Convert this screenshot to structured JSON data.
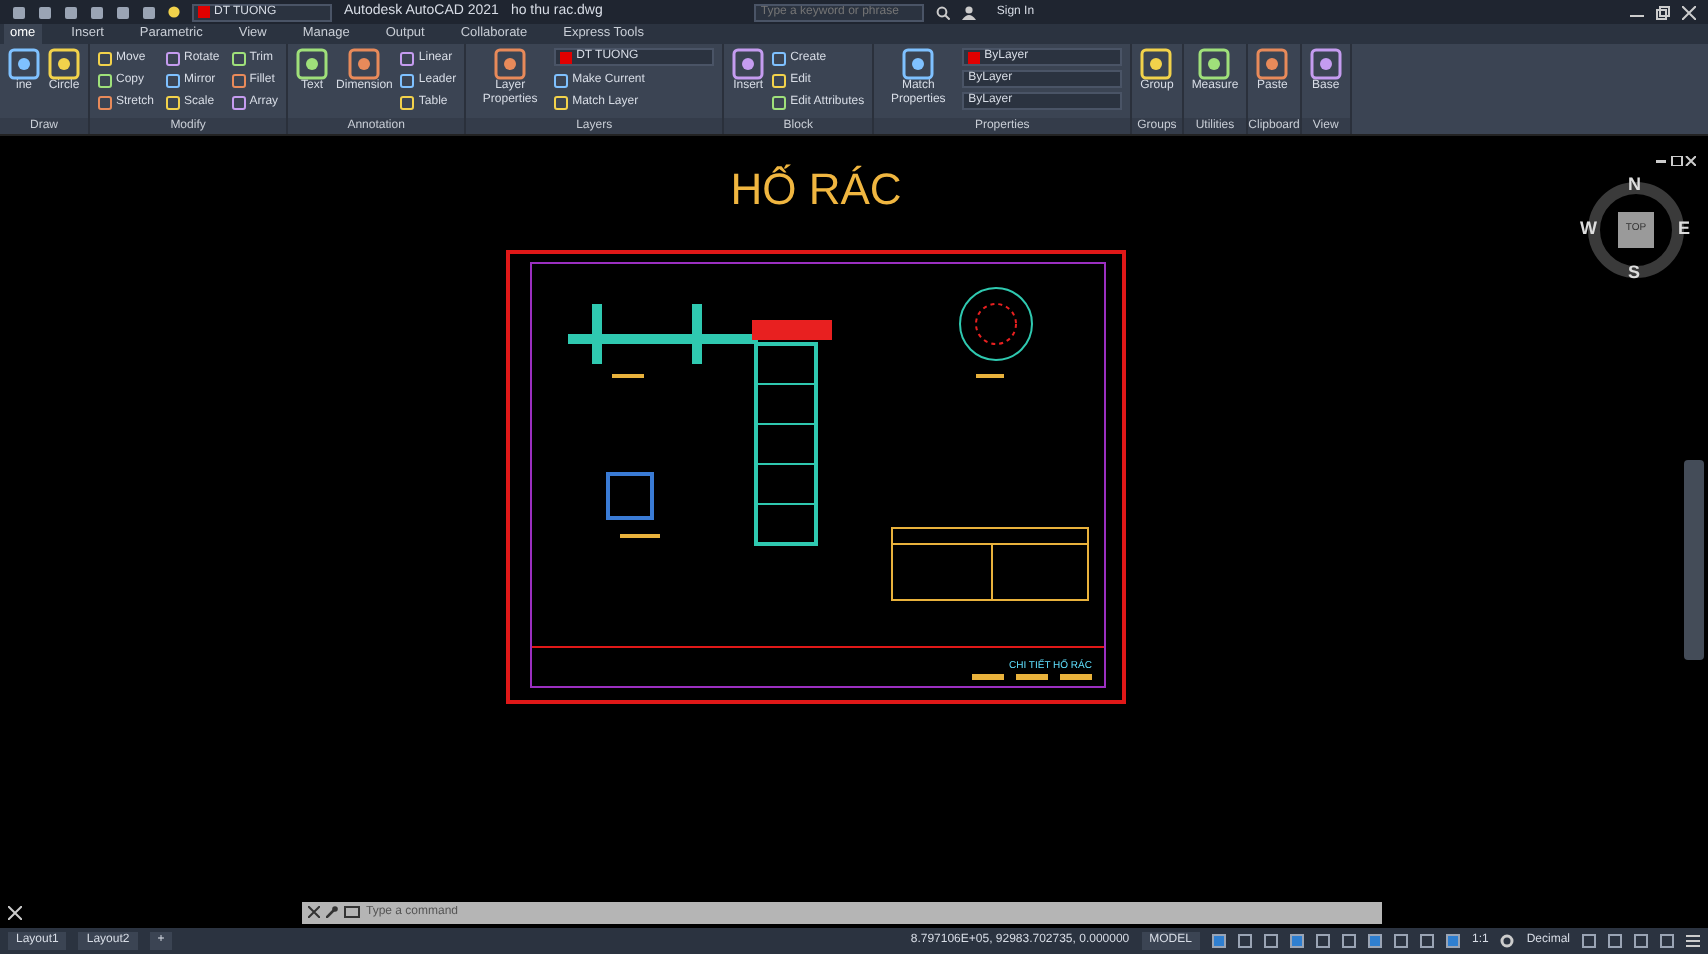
{
  "title_bar": {
    "quick_layer": "DT TUONG",
    "app_title": "Autodesk AutoCAD 2021",
    "file_name": "ho thu rac.dwg",
    "search": {
      "placeholder": "Type a keyword or phrase"
    },
    "sign_in": "Sign In"
  },
  "tabs": [
    {
      "label": "ome",
      "selected": true
    },
    {
      "label": "Insert",
      "selected": false
    },
    {
      "label": "Parametric",
      "selected": false
    },
    {
      "label": "View",
      "selected": false
    },
    {
      "label": "Manage",
      "selected": false
    },
    {
      "label": "Output",
      "selected": false
    },
    {
      "label": "Collaborate",
      "selected": false
    },
    {
      "label": "Express Tools",
      "selected": false
    }
  ],
  "panels": [
    {
      "title": "Draw",
      "tools": [
        {
          "kind": "large",
          "label": "ine"
        },
        {
          "kind": "large",
          "label": "Circle"
        }
      ]
    },
    {
      "title": "Modify",
      "tools": [
        {
          "kind": "small",
          "label": "Move"
        },
        {
          "kind": "small",
          "label": "Copy"
        },
        {
          "kind": "small",
          "label": "Stretch"
        },
        {
          "kind": "small",
          "label": "Rotate"
        },
        {
          "kind": "small",
          "label": "Mirror"
        },
        {
          "kind": "small",
          "label": "Scale"
        },
        {
          "kind": "small",
          "label": "Trim"
        },
        {
          "kind": "small",
          "label": "Fillet"
        },
        {
          "kind": "small",
          "label": "Array"
        }
      ]
    },
    {
      "title": "Annotation",
      "tools": [
        {
          "kind": "large",
          "label": "Text"
        },
        {
          "kind": "large",
          "label": "Dimension"
        },
        {
          "kind": "small",
          "label": "Linear"
        },
        {
          "kind": "small",
          "label": "Leader"
        },
        {
          "kind": "small",
          "label": "Table"
        }
      ]
    },
    {
      "title": "Layers",
      "tools": [
        {
          "kind": "large",
          "label": "Layer Properties"
        },
        {
          "kind": "combo",
          "label": "DT TUONG",
          "color": "#e00000"
        },
        {
          "kind": "small",
          "label": "Make Current"
        },
        {
          "kind": "small",
          "label": "Match Layer"
        }
      ]
    },
    {
      "title": "Block",
      "tools": [
        {
          "kind": "large",
          "label": "Insert"
        },
        {
          "kind": "small",
          "label": "Create"
        },
        {
          "kind": "small",
          "label": "Edit"
        },
        {
          "kind": "small",
          "label": "Edit Attributes"
        }
      ]
    },
    {
      "title": "Properties",
      "tools": [
        {
          "kind": "large",
          "label": "Match Properties"
        },
        {
          "kind": "combo",
          "label": "ByLayer",
          "color": "#e00000"
        },
        {
          "kind": "combo",
          "label": "ByLayer"
        },
        {
          "kind": "combo",
          "label": "ByLayer"
        }
      ]
    },
    {
      "title": "Groups",
      "tools": [
        {
          "kind": "large",
          "label": "Group"
        }
      ]
    },
    {
      "title": "Utilities",
      "tools": [
        {
          "kind": "large",
          "label": "Measure"
        }
      ]
    },
    {
      "title": "Clipboard",
      "tools": [
        {
          "kind": "large",
          "label": "Paste"
        }
      ]
    },
    {
      "title": "View",
      "tools": [
        {
          "kind": "large",
          "label": "Base"
        }
      ]
    }
  ],
  "drawing": {
    "title": "HỐ RÁC",
    "sheet_label": "CHI TIẾT HỐ RÁC"
  },
  "view_cube": {
    "north": "N",
    "south": "S",
    "east": "E",
    "west": "W",
    "face": "TOP"
  },
  "command_line": {
    "placeholder": "Type a command"
  },
  "status_bar": {
    "layouts": [
      {
        "label": "Layout1",
        "selected": false
      },
      {
        "label": "Layout2",
        "selected": false
      }
    ],
    "add": "+",
    "coordinates": "8.797106E+05, 92983.702735, 0.000000",
    "space": "MODEL",
    "scale": "1:1",
    "units": "Decimal"
  }
}
